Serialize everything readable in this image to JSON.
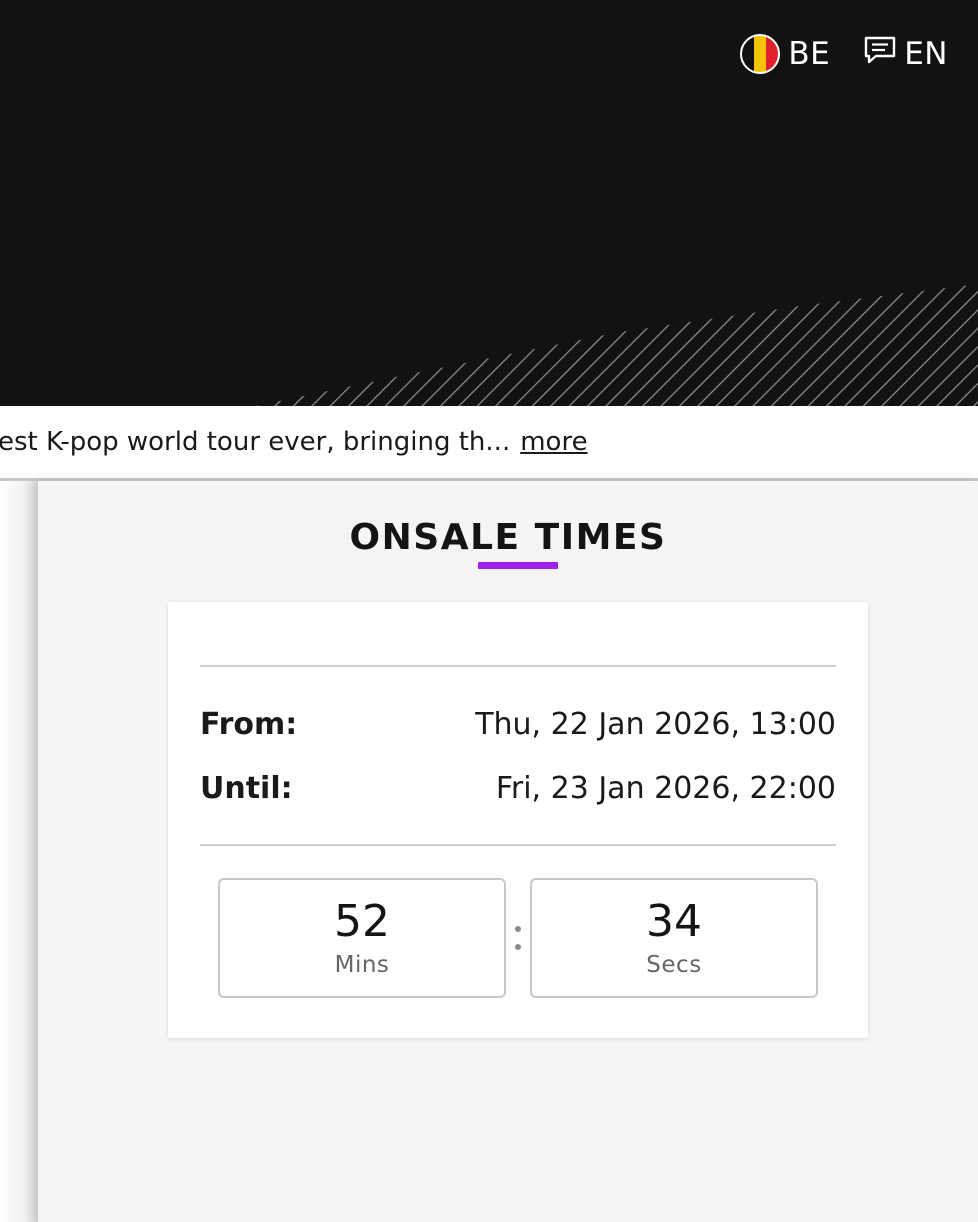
{
  "header": {
    "country_code": "BE",
    "language_code": "EN",
    "flag_icon": "belgium-flag-icon",
    "language_icon": "speech-bubble-icon"
  },
  "event": {
    "description_snippet": "est K-pop world tour ever, bringing th...",
    "more_label": "more"
  },
  "onsale": {
    "title": "ONSALE TIMES",
    "accent_color": "#a020f0",
    "from_label": "From:",
    "from_value": "Thu, 22 Jan 2026, 13:00",
    "until_label": "Until:",
    "until_value": "Fri, 23 Jan 2026, 22:00",
    "countdown": {
      "mins_value": "52",
      "mins_label": "Mins",
      "secs_value": "34",
      "secs_label": "Secs"
    }
  },
  "colors": {
    "hero_background": "#121212",
    "panel_background": "#f5f5f5"
  }
}
